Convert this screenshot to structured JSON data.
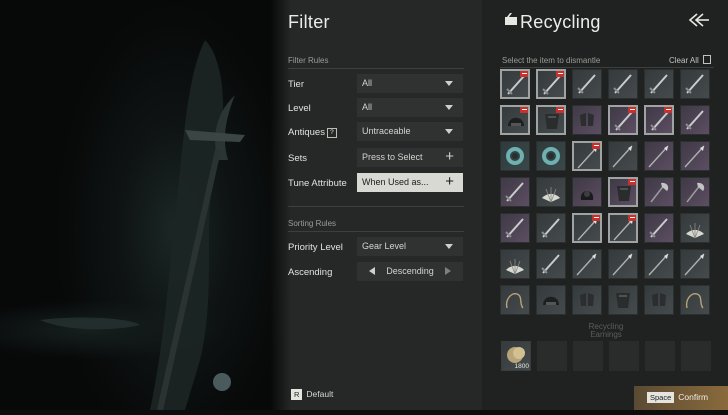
{
  "filter": {
    "title": "Filter",
    "section_rules": "Filter Rules",
    "rows": [
      {
        "label": "Tier",
        "value": "All",
        "control": "dropdown"
      },
      {
        "label": "Level",
        "value": "All",
        "control": "dropdown"
      },
      {
        "label": "Antiques",
        "value": "Untraceable",
        "control": "dropdown",
        "help": "?"
      },
      {
        "label": "Sets",
        "value": "Press to Select",
        "control": "add"
      },
      {
        "label": "Tune Attribute",
        "value": "When Used as...",
        "control": "add"
      }
    ],
    "section_sorting": "Sorting Rules",
    "sort_rows": [
      {
        "label": "Priority Level",
        "value": "Gear Level",
        "control": "dropdown"
      },
      {
        "label": "Ascending",
        "value": "Descending",
        "control": "stepper"
      }
    ]
  },
  "recycling": {
    "title": "Recycling",
    "instruction": "Select the item to dismantle",
    "clear_all": "Clear All",
    "earnings_label": "Recycling\nEarnings",
    "earning_count": "1800",
    "items": [
      {
        "icon": "sword-icon",
        "rarity": "grey",
        "selected": true,
        "marked": true
      },
      {
        "icon": "sword-icon",
        "rarity": "grey",
        "selected": true,
        "marked": true
      },
      {
        "icon": "sword-icon",
        "rarity": "grey",
        "selected": false,
        "marked": false
      },
      {
        "icon": "sword-icon",
        "rarity": "grey",
        "selected": false,
        "marked": false
      },
      {
        "icon": "sword-icon",
        "rarity": "grey",
        "selected": false,
        "marked": false
      },
      {
        "icon": "sword-icon",
        "rarity": "grey",
        "selected": false,
        "marked": false
      },
      {
        "icon": "helmet-icon",
        "rarity": "grey",
        "selected": true,
        "marked": true
      },
      {
        "icon": "armor-icon",
        "rarity": "grey",
        "selected": true,
        "marked": true
      },
      {
        "icon": "gloves-icon",
        "rarity": "purple",
        "selected": false,
        "marked": false
      },
      {
        "icon": "blade-icon",
        "rarity": "purple",
        "selected": true,
        "marked": true
      },
      {
        "icon": "blade-icon",
        "rarity": "purple",
        "selected": true,
        "marked": true
      },
      {
        "icon": "blade-icon",
        "rarity": "purple",
        "selected": false,
        "marked": false
      },
      {
        "icon": "ring-icon",
        "rarity": "teal",
        "selected": false,
        "marked": false
      },
      {
        "icon": "ring-icon",
        "rarity": "teal",
        "selected": false,
        "marked": false
      },
      {
        "icon": "spear-icon",
        "rarity": "grey",
        "selected": true,
        "marked": true
      },
      {
        "icon": "spear-icon",
        "rarity": "grey",
        "selected": false,
        "marked": false
      },
      {
        "icon": "spear-icon",
        "rarity": "purple",
        "selected": false,
        "marked": false
      },
      {
        "icon": "spear-icon",
        "rarity": "purple",
        "selected": false,
        "marked": false
      },
      {
        "icon": "arrow-icon",
        "rarity": "purple",
        "selected": false,
        "marked": false
      },
      {
        "icon": "fan-icon",
        "rarity": "grey",
        "selected": false,
        "marked": false
      },
      {
        "icon": "hood-icon",
        "rarity": "purple",
        "selected": false,
        "marked": false
      },
      {
        "icon": "gauntlet-icon",
        "rarity": "purple",
        "selected": true,
        "marked": true
      },
      {
        "icon": "axe-icon",
        "rarity": "purple",
        "selected": false,
        "marked": false
      },
      {
        "icon": "axe-icon",
        "rarity": "purple",
        "selected": false,
        "marked": false
      },
      {
        "icon": "dagger-icon",
        "rarity": "purple",
        "selected": false,
        "marked": false
      },
      {
        "icon": "dagger-icon",
        "rarity": "grey",
        "selected": false,
        "marked": false
      },
      {
        "icon": "spear-icon",
        "rarity": "grey",
        "selected": true,
        "marked": true
      },
      {
        "icon": "spear-icon",
        "rarity": "grey",
        "selected": true,
        "marked": true
      },
      {
        "icon": "dagger-icon",
        "rarity": "purple",
        "selected": false,
        "marked": false
      },
      {
        "icon": "fan-icon",
        "rarity": "grey",
        "selected": false,
        "marked": false
      },
      {
        "icon": "fan-icon",
        "rarity": "grey",
        "selected": false,
        "marked": false
      },
      {
        "icon": "dagger-icon",
        "rarity": "grey",
        "selected": false,
        "marked": false
      },
      {
        "icon": "spear-icon",
        "rarity": "grey",
        "selected": false,
        "marked": false
      },
      {
        "icon": "spear-icon",
        "rarity": "grey",
        "selected": false,
        "marked": false
      },
      {
        "icon": "spear-icon",
        "rarity": "grey",
        "selected": false,
        "marked": false
      },
      {
        "icon": "spear-icon",
        "rarity": "grey",
        "selected": false,
        "marked": false
      },
      {
        "icon": "whip-icon",
        "rarity": "grey",
        "selected": false,
        "marked": false
      },
      {
        "icon": "helmet-icon",
        "rarity": "grey",
        "selected": false,
        "marked": false
      },
      {
        "icon": "gloves-icon",
        "rarity": "grey",
        "selected": false,
        "marked": false
      },
      {
        "icon": "armor-icon",
        "rarity": "grey",
        "selected": false,
        "marked": false
      },
      {
        "icon": "mask-icon",
        "rarity": "grey",
        "selected": false,
        "marked": false
      },
      {
        "icon": "whip-icon",
        "rarity": "grey",
        "selected": false,
        "marked": false
      }
    ]
  },
  "footer": {
    "default_key": "R",
    "default_label": "Default",
    "confirm_key": "Space",
    "confirm_label": "Confirm"
  },
  "colors": {
    "confirm_accent": "#8a6a3c",
    "mark_red": "#c9302c"
  }
}
